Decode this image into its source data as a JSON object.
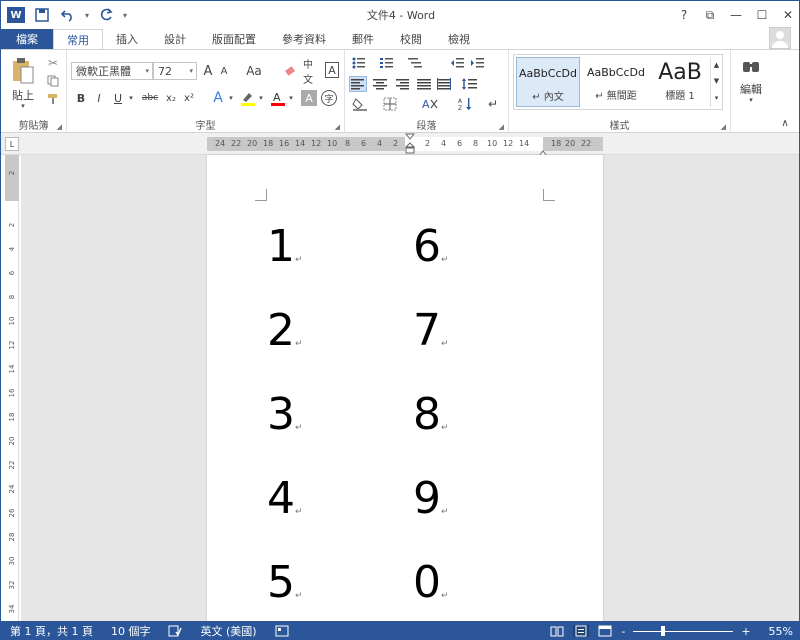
{
  "window": {
    "title": "文件4 - Word"
  },
  "qat": {
    "logo": "W",
    "save_icon": "save-icon",
    "undo_icon": "undo-icon",
    "redo_icon": "redo-icon"
  },
  "win_ctrls": {
    "help": "?",
    "ribbon_display": "⧉",
    "minimize": "—",
    "maximize": "☐",
    "close": "✕"
  },
  "tabs": {
    "file": "檔案",
    "items": [
      "常用",
      "插入",
      "設計",
      "版面配置",
      "參考資料",
      "郵件",
      "校閱",
      "檢視"
    ],
    "active": "常用"
  },
  "ribbon": {
    "clipboard": {
      "label": "剪貼簿",
      "paste": "貼上"
    },
    "font": {
      "label": "字型",
      "font_name": "微軟正黑體",
      "font_size": "72",
      "grow": "A",
      "shrink": "A",
      "case": "Aa",
      "bold": "B",
      "italic": "I",
      "underline": "U",
      "strike": "abc",
      "sub": "x₂",
      "super": "x²",
      "phonetic": "中文",
      "char_border": "A",
      "highlight_color": "#ffff00",
      "font_color": "#ff0000"
    },
    "paragraph": {
      "label": "段落"
    },
    "styles": {
      "label": "樣式",
      "items": [
        {
          "sample": "AaBbCcDd",
          "name": "↵ 內文",
          "selected": true
        },
        {
          "sample": "AaBbCcDd",
          "name": "↵ 無間距",
          "selected": false
        },
        {
          "sample": "AaB",
          "name": "標題 1",
          "selected": false
        }
      ]
    },
    "editing": {
      "label": "編輯"
    }
  },
  "ruler": {
    "corner": "L",
    "h_ticks": [
      "24",
      "22",
      "20",
      "18",
      "16",
      "14",
      "12",
      "10",
      "8",
      "6",
      "4",
      "2",
      "",
      "2",
      "4",
      "6",
      "8",
      "10",
      "12",
      "14",
      "",
      "18",
      "20",
      "22"
    ],
    "v_ticks": [
      "2",
      "2",
      "4",
      "6",
      "8",
      "10",
      "12",
      "14",
      "16",
      "18",
      "20",
      "22",
      "24",
      "26",
      "28",
      "30",
      "32",
      "34"
    ]
  },
  "document": {
    "left_column": [
      "1",
      "2",
      "3",
      "4",
      "5"
    ],
    "right_column": [
      "6",
      "7",
      "8",
      "9",
      "0"
    ],
    "para_mark": "↵"
  },
  "status": {
    "page": "第 1 頁，共 1 頁",
    "words": "10 個字",
    "language": "英文 (美國)",
    "zoom": "55%",
    "zoom_minus": "-",
    "zoom_plus": "+"
  },
  "colors": {
    "accent": "#2b579a"
  }
}
